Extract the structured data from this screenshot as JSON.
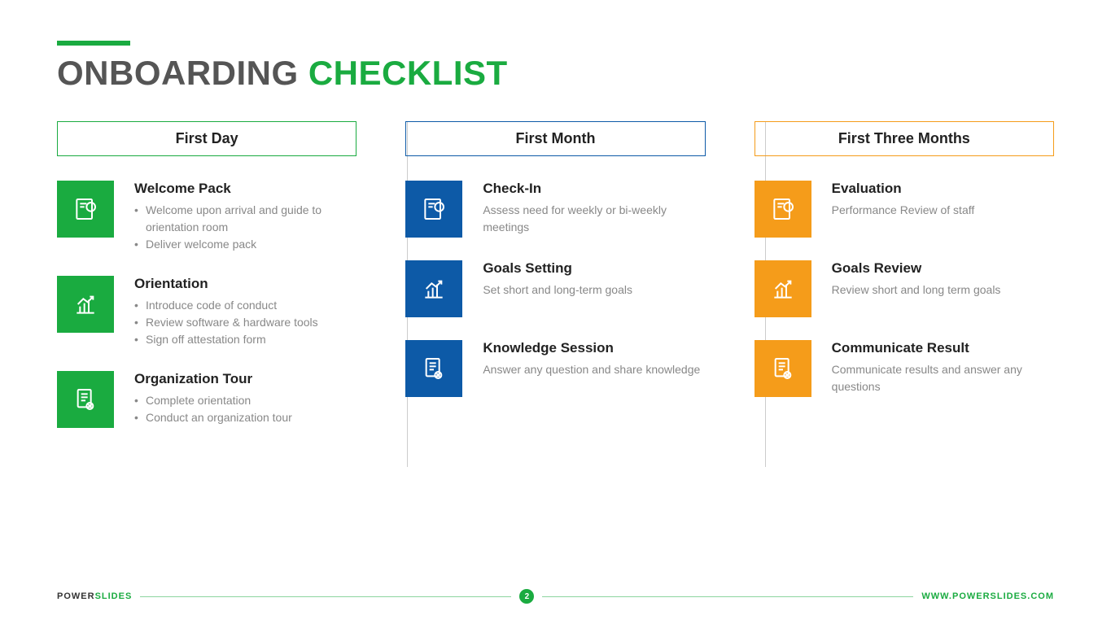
{
  "title": {
    "part1": "ONBOARDING ",
    "part2": "CHECKLIST"
  },
  "columns": [
    {
      "header": "First Day",
      "color": "#1aab40",
      "items": [
        {
          "icon": "doc",
          "title": "Welcome Pack",
          "bullets": [
            "Welcome upon arrival and guide to orientation room",
            "Deliver welcome pack"
          ]
        },
        {
          "icon": "chart",
          "title": "Orientation",
          "bullets": [
            "Introduce code of conduct",
            "Review software & hardware tools",
            "Sign off attestation form"
          ]
        },
        {
          "icon": "file",
          "title": "Organization Tour",
          "bullets": [
            "Complete orientation",
            "Conduct an organization tour"
          ]
        }
      ]
    },
    {
      "header": "First Month",
      "color": "#0d5aa7",
      "items": [
        {
          "icon": "doc",
          "title": "Check-In",
          "desc": "Assess need for weekly or bi-weekly meetings"
        },
        {
          "icon": "chart",
          "title": "Goals Setting",
          "desc": "Set short and long-term goals"
        },
        {
          "icon": "file",
          "title": "Knowledge Session",
          "desc": "Answer any question and share knowledge"
        }
      ]
    },
    {
      "header": "First Three Months",
      "color": "#f59c1a",
      "items": [
        {
          "icon": "doc",
          "title": "Evaluation",
          "desc": "Performance Review of staff"
        },
        {
          "icon": "chart",
          "title": "Goals Review",
          "desc": "Review short and long term goals"
        },
        {
          "icon": "file",
          "title": "Communicate Result",
          "desc": "Communicate results and answer any questions"
        }
      ]
    }
  ],
  "footer": {
    "brand1": "POWER",
    "brand2": "SLIDES",
    "page": "2",
    "url": "WWW.POWERSLIDES.COM"
  }
}
